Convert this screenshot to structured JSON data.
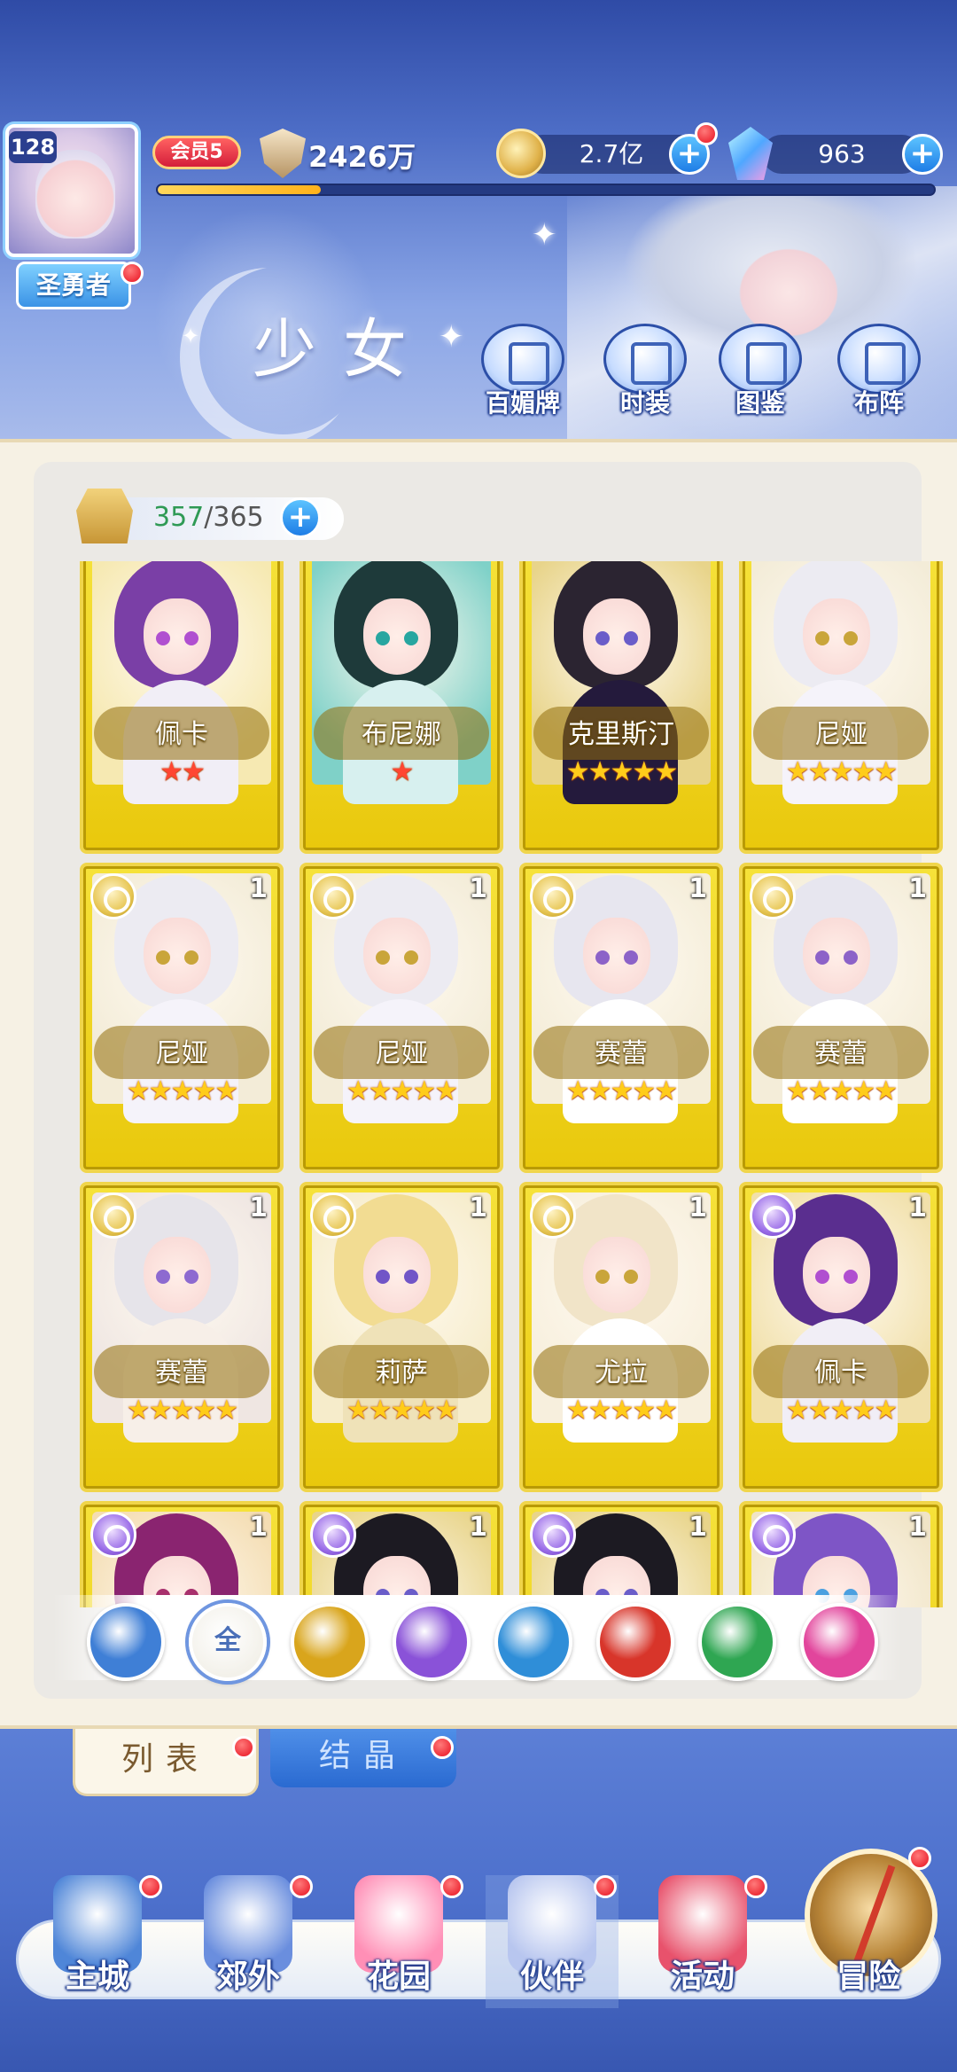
{
  "player": {
    "level": "128",
    "title": "圣勇者",
    "vip": "会员5",
    "power": "2426万",
    "exp_fraction": 0.21
  },
  "resources": {
    "gold": "2.7亿",
    "gems": "963"
  },
  "page": {
    "title": "少女"
  },
  "top_buttons": [
    {
      "label": "百媚牌",
      "icon": "card-deck-icon"
    },
    {
      "label": "时装",
      "icon": "outfit-icon"
    },
    {
      "label": "图鉴",
      "icon": "book-icon"
    },
    {
      "label": "布阵",
      "icon": "formation-grid-icon"
    }
  ],
  "capacity": {
    "current": "357",
    "max": "/365"
  },
  "cards": [
    {
      "name": "佩卡",
      "stars": 2,
      "star_color": "red",
      "element": "",
      "count": ""
    },
    {
      "name": "布尼娜",
      "stars": 1,
      "star_color": "red",
      "element": "",
      "count": ""
    },
    {
      "name": "克里斯汀",
      "stars": 5,
      "star_color": "gold",
      "element": "",
      "count": ""
    },
    {
      "name": "尼娅",
      "stars": 5,
      "star_color": "gold",
      "element": "",
      "count": ""
    },
    {
      "name": "尼娅",
      "stars": 5,
      "star_color": "gold",
      "element": "sun",
      "count": "1"
    },
    {
      "name": "尼娅",
      "stars": 5,
      "star_color": "gold",
      "element": "sun",
      "count": "1"
    },
    {
      "name": "赛蕾",
      "stars": 5,
      "star_color": "gold",
      "element": "sun",
      "count": "1"
    },
    {
      "name": "赛蕾",
      "stars": 5,
      "star_color": "gold",
      "element": "sun",
      "count": "1"
    },
    {
      "name": "赛蕾",
      "stars": 5,
      "star_color": "gold",
      "element": "sun",
      "count": "1"
    },
    {
      "name": "莉萨",
      "stars": 5,
      "star_color": "gold",
      "element": "sun",
      "count": "1"
    },
    {
      "name": "尤拉",
      "stars": 5,
      "star_color": "gold",
      "element": "sun",
      "count": "1"
    },
    {
      "name": "佩卡",
      "stars": 5,
      "star_color": "gold",
      "element": "moon",
      "count": "1"
    },
    {
      "name": "",
      "stars": 0,
      "star_color": "gold",
      "element": "moon",
      "count": "1"
    },
    {
      "name": "",
      "stars": 0,
      "star_color": "gold",
      "element": "moon",
      "count": "1"
    },
    {
      "name": "",
      "stars": 0,
      "star_color": "gold",
      "element": "moon",
      "count": "1"
    },
    {
      "name": "",
      "stars": 0,
      "star_color": "gold",
      "element": "moon",
      "count": "1"
    }
  ],
  "filters": [
    {
      "label": "",
      "icon": "star-guide-icon",
      "color": "#3f7fd6"
    },
    {
      "label": "全",
      "icon": "all-icon",
      "color": "#6f96e0",
      "selected": true
    },
    {
      "label": "",
      "icon": "sun-element-icon",
      "color": "#d9a51c"
    },
    {
      "label": "",
      "icon": "moon-element-icon",
      "color": "#8a52d8"
    },
    {
      "label": "",
      "icon": "water-element-icon",
      "color": "#2f8ed8"
    },
    {
      "label": "",
      "icon": "fire-element-icon",
      "color": "#d8352a"
    },
    {
      "label": "",
      "icon": "wind-element-icon",
      "color": "#2fa652"
    },
    {
      "label": "",
      "icon": "heart-element-icon",
      "color": "#e2459c"
    }
  ],
  "tabs": {
    "list": "列表",
    "crystal": "结晶"
  },
  "nav": [
    {
      "label": "主城",
      "icon": "castle-icon"
    },
    {
      "label": "郊外",
      "icon": "portal-icon"
    },
    {
      "label": "花园",
      "icon": "heart-garden-icon"
    },
    {
      "label": "伙伴",
      "icon": "partner-icon"
    },
    {
      "label": "活动",
      "icon": "gift-icon"
    },
    {
      "label": "冒险",
      "icon": "compass-icon"
    }
  ]
}
